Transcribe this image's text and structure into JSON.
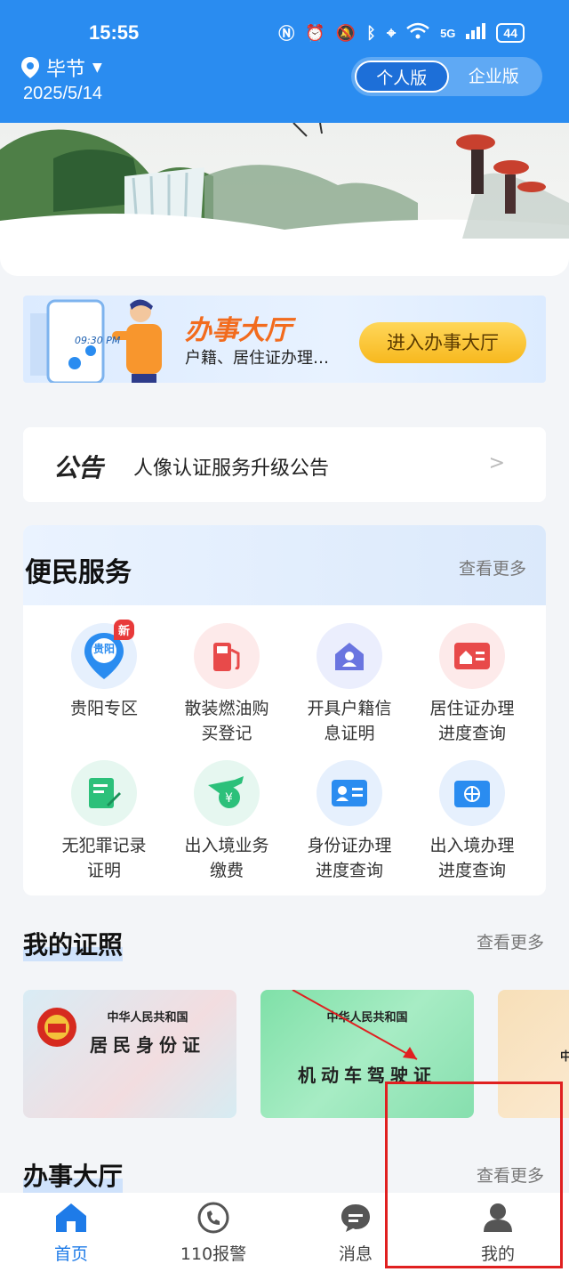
{
  "status_bar": {
    "time": "15:55",
    "network": "5G",
    "battery": "44"
  },
  "header": {
    "city": "毕节",
    "date": "2025/5/14",
    "toggle": {
      "personal": "个人版",
      "enterprise": "企业版"
    }
  },
  "hall_banner": {
    "phone_time": "09:30 PM",
    "title": "办事大厅",
    "subtitle": "户籍、居住证办理…",
    "button": "进入办事大厅"
  },
  "notice": {
    "tag": "公告",
    "text": "人像认证服务升级公告",
    "arrow": ">"
  },
  "services": {
    "title": "便民服务",
    "more": "查看更多",
    "items": [
      {
        "label_1": "贵阳专区",
        "label_2": "",
        "icon": "map-pin-icon",
        "badge": "新",
        "icon_text": "贵阳"
      },
      {
        "label_1": "散装燃油购",
        "label_2": "买登记",
        "icon": "fuel-pump-icon"
      },
      {
        "label_1": "开具户籍信",
        "label_2": "息证明",
        "icon": "household-icon"
      },
      {
        "label_1": "居住证办理",
        "label_2": "进度查询",
        "icon": "residence-card-icon"
      },
      {
        "label_1": "无犯罪记录",
        "label_2": "证明",
        "icon": "document-pen-icon"
      },
      {
        "label_1": "出入境业务",
        "label_2": "缴费",
        "icon": "plane-payment-icon"
      },
      {
        "label_1": "身份证办理",
        "label_2": "进度查询",
        "icon": "id-card-icon"
      },
      {
        "label_1": "出入境办理",
        "label_2": "进度查询",
        "icon": "passport-icon"
      }
    ]
  },
  "certs": {
    "title": "我的证照",
    "more": "查看更多",
    "cards": [
      {
        "top": "中华人民共和国",
        "main": "居民身份证"
      },
      {
        "top": "中华人民共和国",
        "main": "机动车驾驶证"
      },
      {
        "top": "中",
        "main": ""
      }
    ]
  },
  "hall_section": {
    "title": "办事大厅",
    "more": "查看更多"
  },
  "tabbar": [
    {
      "label": "首页",
      "icon": "home-icon",
      "active": true
    },
    {
      "label": "110报警",
      "icon": "phone-icon"
    },
    {
      "label": "消息",
      "icon": "chat-bubble-icon"
    },
    {
      "label": "我的",
      "icon": "user-icon"
    }
  ]
}
